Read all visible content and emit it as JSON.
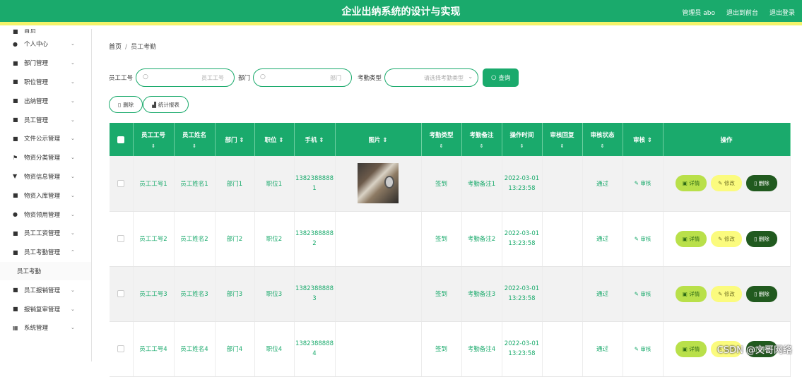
{
  "header": {
    "title": "企业出纳系统的设计与实现",
    "user_label": "管理员 abo",
    "back_front": "退出到前台",
    "logout": "退出登录"
  },
  "sidebar": {
    "items": [
      {
        "label": "首页",
        "icon": "home-icon"
      },
      {
        "label": "个人中心",
        "icon": "user-icon"
      },
      {
        "label": "部门管理",
        "icon": "folder-icon"
      },
      {
        "label": "职位管理",
        "icon": "briefcase-icon"
      },
      {
        "label": "出纳管理",
        "icon": "wallet-icon"
      },
      {
        "label": "员工管理",
        "icon": "users-icon"
      },
      {
        "label": "文件公示管理",
        "icon": "file-icon"
      },
      {
        "label": "物资分类管理",
        "icon": "flag-icon"
      },
      {
        "label": "物资信息管理",
        "icon": "info-icon"
      },
      {
        "label": "物资入库管理",
        "icon": "inbox-icon"
      },
      {
        "label": "物资领用管理",
        "icon": "user-icon"
      },
      {
        "label": "员工工资管理",
        "icon": "money-icon"
      },
      {
        "label": "员工考勤管理",
        "icon": "clock-icon"
      },
      {
        "label": "员工考勤",
        "icon": ""
      },
      {
        "label": "员工报销管理",
        "icon": "grid-icon"
      },
      {
        "label": "报销复审管理",
        "icon": "grid-icon"
      },
      {
        "label": "系统管理",
        "icon": "settings-icon"
      }
    ]
  },
  "breadcrumb": {
    "home": "首页",
    "sep": "/",
    "current": "员工考勤"
  },
  "filters": {
    "emp_no_label": "员工工号",
    "emp_no_placeholder": "员工工号",
    "dept_label": "部门",
    "dept_placeholder": "部门",
    "type_label": "考勤类型",
    "type_placeholder": "请选择考勤类型",
    "search_button": "查询"
  },
  "toolbar": {
    "delete_label": "删除",
    "report_label": "统计报表"
  },
  "table": {
    "columns": [
      "员工工号",
      "员工姓名",
      "部门",
      "职位",
      "手机",
      "图片",
      "考勤类型",
      "考勤备注",
      "操作时间",
      "审核回复",
      "审核状态",
      "审核",
      "操作"
    ],
    "sort_glyph": "⇕",
    "rows": [
      {
        "emp_no": "员工工号1",
        "name": "员工姓名1",
        "dept": "部门1",
        "position": "职位1",
        "phone1": "1382388888",
        "phone2": "1",
        "has_photo": true,
        "type": "签到",
        "remark": "考勤备注1",
        "date": "2022-03-01",
        "time": "13:23:58",
        "reply": "",
        "status": "通过",
        "review": "审核"
      },
      {
        "emp_no": "员工工号2",
        "name": "员工姓名2",
        "dept": "部门2",
        "position": "职位2",
        "phone1": "1382388888",
        "phone2": "2",
        "has_photo": false,
        "type": "签到",
        "remark": "考勤备注2",
        "date": "2022-03-01",
        "time": "13:23:58",
        "reply": "",
        "status": "通过",
        "review": "审核"
      },
      {
        "emp_no": "员工工号3",
        "name": "员工姓名3",
        "dept": "部门3",
        "position": "职位3",
        "phone1": "1382388888",
        "phone2": "3",
        "has_photo": false,
        "type": "签到",
        "remark": "考勤备注3",
        "date": "2022-03-01",
        "time": "13:23:58",
        "reply": "",
        "status": "通过",
        "review": "审核"
      },
      {
        "emp_no": "员工工号4",
        "name": "员工姓名4",
        "dept": "部门4",
        "position": "职位4",
        "phone1": "1382388888",
        "phone2": "4",
        "has_photo": false,
        "type": "签到",
        "remark": "考勤备注4",
        "date": "2022-03-01",
        "time": "13:23:58",
        "reply": "",
        "status": "通过",
        "review": "审核"
      }
    ],
    "row_actions": {
      "detail": "详情",
      "edit": "修改",
      "delete": "删除"
    }
  },
  "watermark": "CSDN @文哥网络",
  "colors": {
    "primary": "#1aaa6c",
    "accent_yellow": "#f3f36a",
    "detail_btn": "#b9e04a",
    "edit_btn": "#fbfb7e",
    "delete_btn": "#215a1f"
  }
}
